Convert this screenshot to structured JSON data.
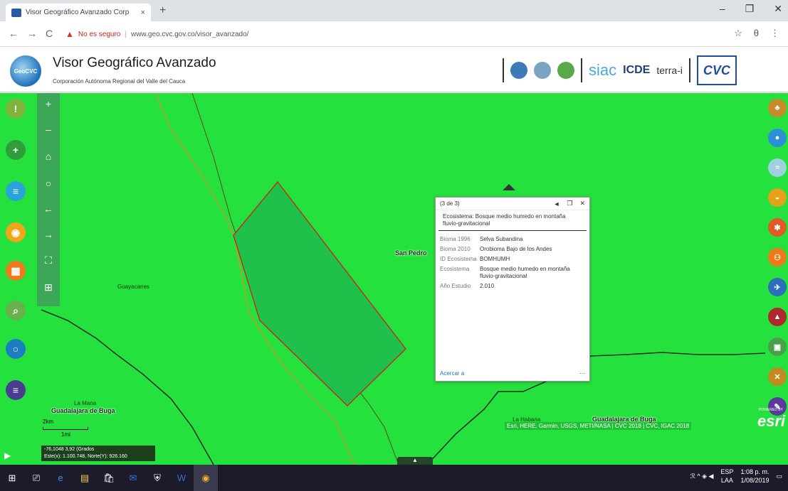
{
  "browser": {
    "tab_title": "Visor Geográfico Avanzado Corp",
    "tab_close": "×",
    "new_tab": "+",
    "window_controls": [
      "–",
      "❐",
      "✕"
    ],
    "back": "←",
    "forward": "→",
    "reload": "C",
    "security_warning": "No es seguro",
    "url": "www.geo.cvc.gov.co/visor_avanzado/",
    "bookmark_icon": "☆",
    "profile_icon": "θ",
    "menu_icon": "⋮"
  },
  "header": {
    "logo_text": "GeoCVC",
    "title": "Visor Geográfico Avanzado",
    "subtitle": "Corporación Autónoma Regional del Valle del Cauca",
    "partners": [
      "siac",
      "ICDE",
      "terra-i",
      "CVC"
    ]
  },
  "map": {
    "labels": [
      {
        "text": "Guayacanes",
        "bold": false
      },
      {
        "text": "San Pedro",
        "bold": true
      },
      {
        "text": "La Mana",
        "bold": false
      },
      {
        "text": "Guadalajara de Buga",
        "bold": true
      },
      {
        "text": "La Habana",
        "bold": false
      },
      {
        "text": "Guadalajara de Buga",
        "bold": true
      }
    ],
    "scale_top": "2km",
    "scale_bottom": "1mi",
    "coords_line1": "-76,1048 3,92 (Grados",
    "coords_line2": "Este(x): 1.100.748, Norte(Y): 926.160",
    "attribution": "Esri, HERE, Garmin, USGS, METI/NASA | CVC 2018 | CVC, IGAC 2018",
    "esri": "esri",
    "esri_small": "POWERED BY",
    "handle_icon": "▲",
    "expand_icon": "▶"
  },
  "nav_tools": [
    "+",
    "–",
    "⌂",
    "○",
    "←",
    "→",
    "⛶",
    "⊞"
  ],
  "left_tools": [
    {
      "icon": "pin-icon",
      "glyph": "!",
      "color": "#7fb33a"
    },
    {
      "icon": "add-icon",
      "glyph": "+",
      "color": "#2e9d3a"
    },
    {
      "icon": "layers-icon",
      "glyph": "≡",
      "color": "#29a3d8"
    },
    {
      "icon": "location-icon",
      "glyph": "◉",
      "color": "#f2a516"
    },
    {
      "icon": "calculator-icon",
      "glyph": "▦",
      "color": "#f07a1b"
    },
    {
      "icon": "search-icon",
      "glyph": "⌕",
      "color": "#6ab04c"
    },
    {
      "icon": "circle-icon",
      "glyph": "○",
      "color": "#1c7ec1"
    },
    {
      "icon": "menu-icon",
      "glyph": "≡",
      "color": "#4a3d8f"
    }
  ],
  "right_tools": [
    {
      "icon": "tree-icon",
      "color": "#c98b2a"
    },
    {
      "icon": "water-drop-icon",
      "color": "#2d8fd6"
    },
    {
      "icon": "wind-icon",
      "color": "#9fd0e0"
    },
    {
      "icon": "turtle-icon",
      "color": "#e6a11a"
    },
    {
      "icon": "hazard-icon",
      "color": "#e05a27"
    },
    {
      "icon": "people-icon",
      "color": "#f07818"
    },
    {
      "icon": "runner-icon",
      "color": "#2a6fb8"
    },
    {
      "icon": "mountain-icon",
      "color": "#b0282e"
    },
    {
      "icon": "picture-icon",
      "color": "#4aa04a"
    },
    {
      "icon": "tools-icon",
      "color": "#c48a1f"
    },
    {
      "icon": "pencil-icon",
      "color": "#5a3b9a"
    }
  ],
  "popup": {
    "count": "(3 de 3)",
    "prev": "◄",
    "max": "❐",
    "close": "✕",
    "title": "Ecosistema: Bosque medio humedo en montaña fluvio-gravitacional",
    "rows": [
      {
        "key": "Bioma 1996",
        "value": "Selva Subandina"
      },
      {
        "key": "Bioma 2010",
        "value": "Orobioma Bajo de los Andes"
      },
      {
        "key": "ID Ecosistema",
        "value": "BOMHUMH"
      },
      {
        "key": "Ecosistema",
        "value": "Bosque medio humedo en montaña fluvio-gravitacional"
      },
      {
        "key": "Año Estudio",
        "value": "2.010"
      }
    ],
    "zoom_label": "Acercar a",
    "more": "···"
  },
  "taskbar": {
    "icons": [
      "⊞",
      "⎚",
      "e",
      "▤",
      "🛍",
      "✉",
      "⛨",
      "W",
      "◉"
    ],
    "tray_icons": "ℛ  ^ ◈ ◀",
    "lang1": "ESP",
    "lang2": "LAA",
    "time": "1:08 p. m.",
    "date": "1/08/2019",
    "notif": "▭"
  }
}
